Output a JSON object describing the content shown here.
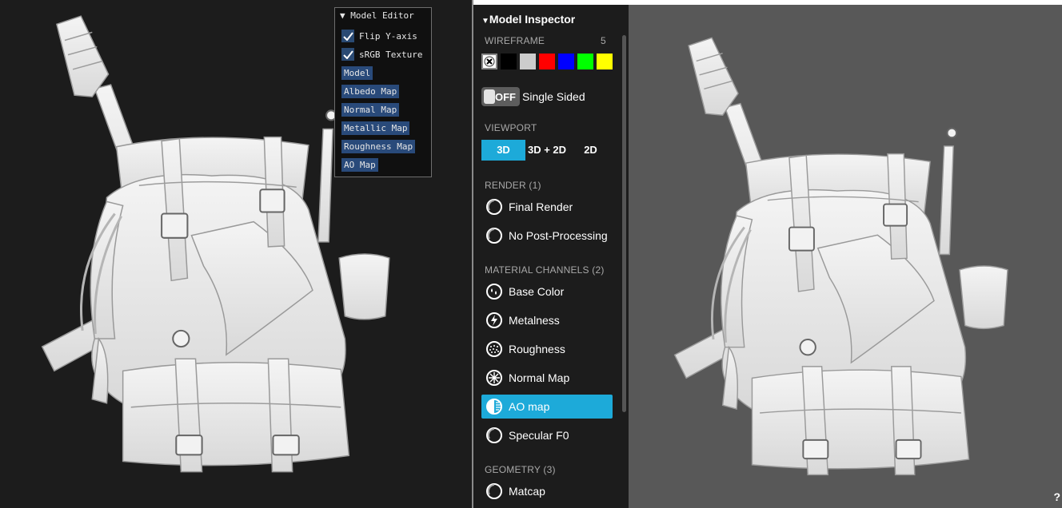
{
  "model_editor": {
    "title": "Model Editor",
    "checkboxes": [
      {
        "label": "Flip Y-axis",
        "checked": true
      },
      {
        "label": "sRGB Texture",
        "checked": true
      }
    ],
    "buttons": [
      "Model",
      "Albedo Map",
      "Normal Map",
      "Metallic Map",
      "Roughness Map",
      "AO Map"
    ]
  },
  "inspector": {
    "title": "Model Inspector",
    "wireframe": {
      "label": "WIREFRAME",
      "count": "5",
      "colors": [
        "#ffffff",
        "#000000",
        "#cccccc",
        "#ff0000",
        "#0000ff",
        "#00ff00",
        "#ffff00"
      ]
    },
    "single_sided": {
      "toggle_text": "OFF",
      "label": "Single Sided"
    },
    "viewport": {
      "label": "VIEWPORT",
      "options": [
        "3D",
        "3D + 2D",
        "2D"
      ],
      "selected": "3D"
    },
    "render": {
      "label": "RENDER (1)",
      "items": [
        {
          "label": "Final Render",
          "icon": "circle-icon"
        },
        {
          "label": "No Post-Processing",
          "icon": "circle-icon"
        }
      ]
    },
    "material_channels": {
      "label": "MATERIAL CHANNELS (2)",
      "items": [
        {
          "label": "Base Color",
          "icon": "color-drops-icon"
        },
        {
          "label": "Metalness",
          "icon": "lightning-icon"
        },
        {
          "label": "Roughness",
          "icon": "dotted-sphere-icon"
        },
        {
          "label": "Normal Map",
          "icon": "normal-map-icon"
        },
        {
          "label": "AO map",
          "icon": "ao-icon",
          "active": true
        },
        {
          "label": "Specular F0",
          "icon": "circle-icon"
        }
      ]
    },
    "geometry": {
      "label": "GEOMETRY (3)",
      "items": [
        {
          "label": "Matcap",
          "icon": "circle-icon"
        }
      ]
    }
  },
  "accent_color": "#1daad9",
  "help_glyph": "?"
}
